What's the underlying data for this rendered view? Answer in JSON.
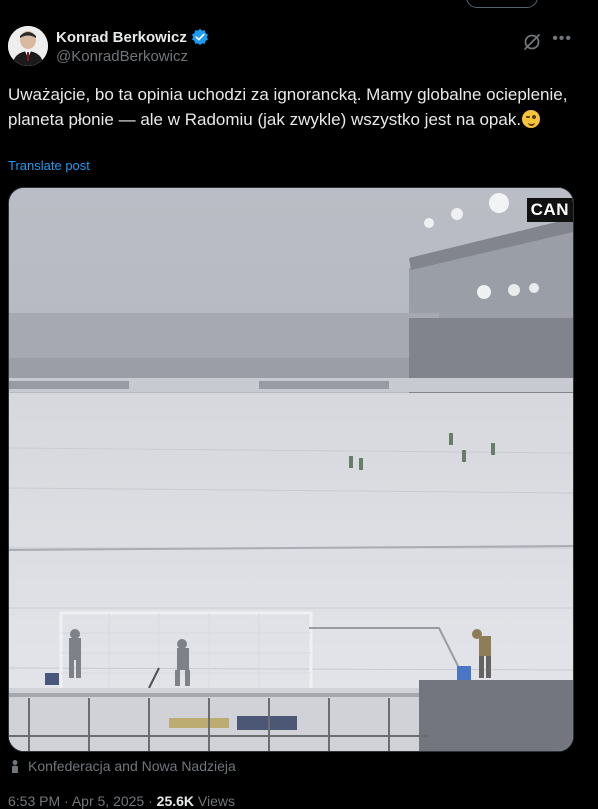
{
  "author": {
    "name": "Konrad Berkowicz",
    "handle": "@KonradBerkowicz",
    "verified": true,
    "verified_color": "#1d9bf0"
  },
  "post": {
    "text": "Uważajcie, bo ta opinia uchodzi za ignorancką. Mamy globalne ocieplenie, planeta płonie — ale w Radomiu (jak zwykle) wszystko jest na opak.",
    "emoji_name": "winking-face",
    "translate_label": "Translate post"
  },
  "media": {
    "description_icon": "snow-covered-stadium-image",
    "broadcaster_logo": "CAN"
  },
  "context": {
    "icon": "person-icon",
    "text": "Konfederacja and Nowa Nadzieja"
  },
  "meta": {
    "time": "6:53 PM",
    "separator": "·",
    "date": "Apr 5, 2025",
    "views_count": "25.6K",
    "views_label": "Views"
  },
  "actions": {
    "grok_icon": "grok-icon",
    "more_icon": "more-icon"
  },
  "colors": {
    "background": "#000000",
    "text": "#e7e9ea",
    "secondary": "#71767b",
    "link": "#1d9bf0"
  }
}
